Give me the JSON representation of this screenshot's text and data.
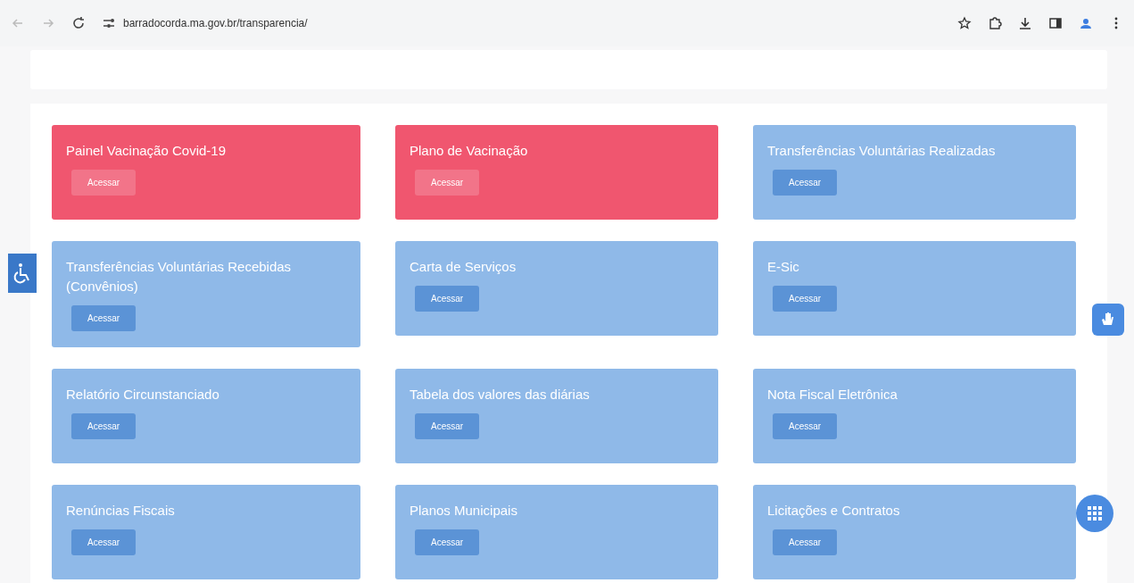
{
  "browser": {
    "url": "barradocorda.ma.gov.br/transparencia/"
  },
  "cards": [
    {
      "title": "Painel Vacinação Covid-19",
      "button": "Acessar",
      "color": "#f0566f"
    },
    {
      "title": "Plano de Vacinação",
      "button": "Acessar",
      "color": "#f0566f"
    },
    {
      "title": "Transferências Voluntárias Realizadas",
      "button": "Acessar",
      "color": "#8fb9e8"
    },
    {
      "title": "Transferências Voluntárias Recebidas (Convênios)",
      "button": "Acessar",
      "color": "#8fb9e8"
    },
    {
      "title": "Carta de Serviços",
      "button": "Acessar",
      "color": "#8fb9e8"
    },
    {
      "title": "E-Sic",
      "button": "Acessar",
      "color": "#8fb9e8"
    },
    {
      "title": "Relatório Circunstanciado",
      "button": "Acessar",
      "color": "#8fb9e8"
    },
    {
      "title": "Tabela dos valores das diárias",
      "button": "Acessar",
      "color": "#8fb9e8"
    },
    {
      "title": "Nota Fiscal Eletrônica",
      "button": "Acessar",
      "color": "#8fb9e8"
    },
    {
      "title": "Renúncias Fiscais",
      "button": "Acessar",
      "color": "#8fb9e8"
    },
    {
      "title": "Planos Municipais",
      "button": "Acessar",
      "color": "#8fb9e8"
    },
    {
      "title": "Licitações e Contratos",
      "button": "Acessar",
      "color": "#8fb9e8"
    }
  ]
}
